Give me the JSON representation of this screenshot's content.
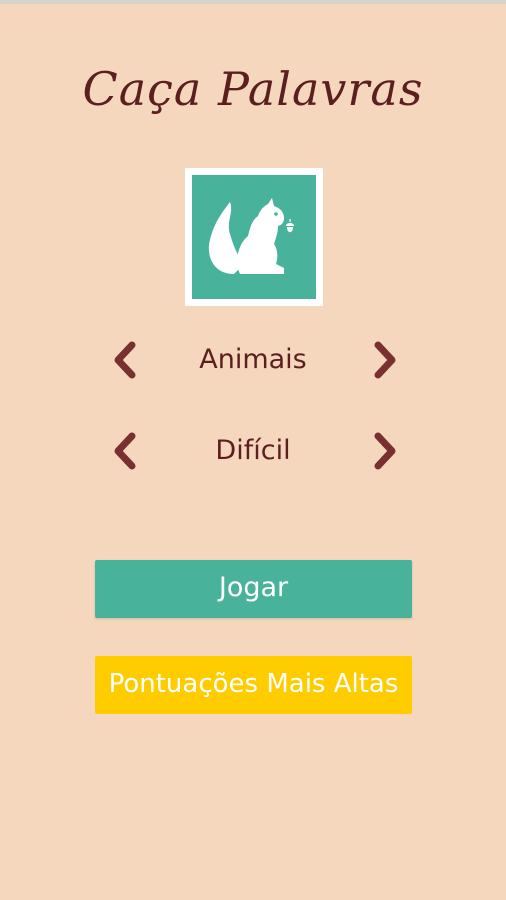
{
  "app": {
    "title": "Caça Palavras"
  },
  "logo": {
    "icon": "squirrel-icon",
    "background_color": "#49b29a"
  },
  "category_selector": {
    "value": "Animais",
    "prev_icon": "chevron-left-icon",
    "next_icon": "chevron-right-icon"
  },
  "difficulty_selector": {
    "value": "Difícil",
    "prev_icon": "chevron-left-icon",
    "next_icon": "chevron-right-icon"
  },
  "buttons": {
    "play_label": "Jogar",
    "high_scores_label": "Pontuações Mais Altas"
  },
  "colors": {
    "background": "#f5d7bd",
    "text": "#5b1f1f",
    "accent": "#49b29a",
    "highlight": "#ffcc00",
    "arrow": "#7a3030"
  }
}
